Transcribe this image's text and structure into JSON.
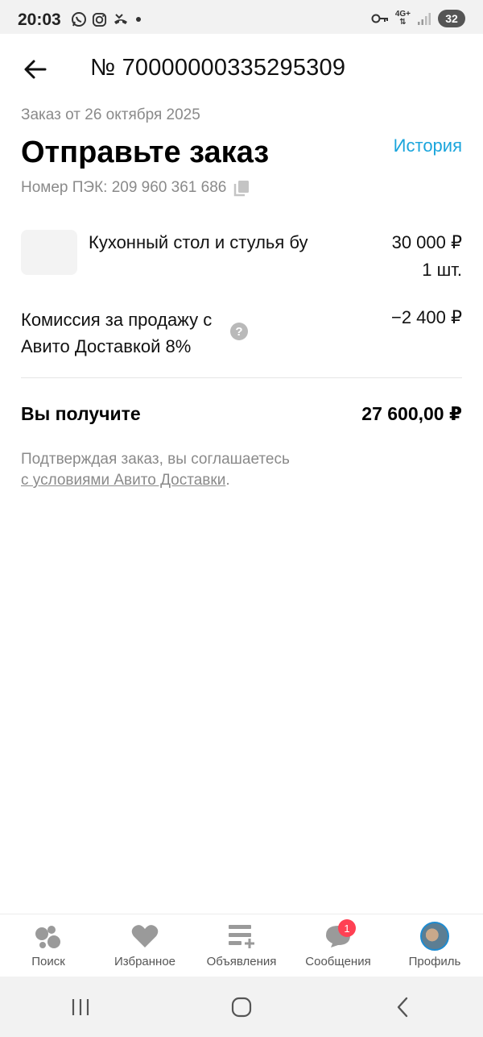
{
  "status_bar": {
    "time": "20:03",
    "network": "4G+",
    "battery": "32"
  },
  "header": {
    "order_number": "№ 70000000335295309"
  },
  "order": {
    "date_text": "Заказ от 26 октября 2025",
    "title": "Отправьте заказ",
    "history_label": "История",
    "pek_text": "Номер ПЭК: 209 960 361 686"
  },
  "item": {
    "title": "Кухонный стол и стулья бу",
    "price": "30 000 ₽",
    "quantity": "1 шт."
  },
  "commission": {
    "label": "Комиссия за продажу с Авито Доставкой 8%",
    "value": "−2 400 ₽",
    "help": "?"
  },
  "total": {
    "label": "Вы получите",
    "value": "27 600,00 ₽"
  },
  "terms": {
    "text": "Подтверждая заказ, вы соглашаетесь",
    "link": "с условиями Авито Доставки",
    "suffix": "."
  },
  "bottom_nav": {
    "items": [
      {
        "label": "Поиск",
        "icon": "search-dots-icon"
      },
      {
        "label": "Избранное",
        "icon": "heart-icon"
      },
      {
        "label": "Объявления",
        "icon": "add-listing-icon"
      },
      {
        "label": "Сообщения",
        "icon": "chat-icon",
        "badge": "1"
      },
      {
        "label": "Профиль",
        "icon": "avatar"
      }
    ]
  },
  "colors": {
    "accent": "#1aa5dc",
    "badge": "#ff4053",
    "muted_text": "#8a8a8a"
  }
}
